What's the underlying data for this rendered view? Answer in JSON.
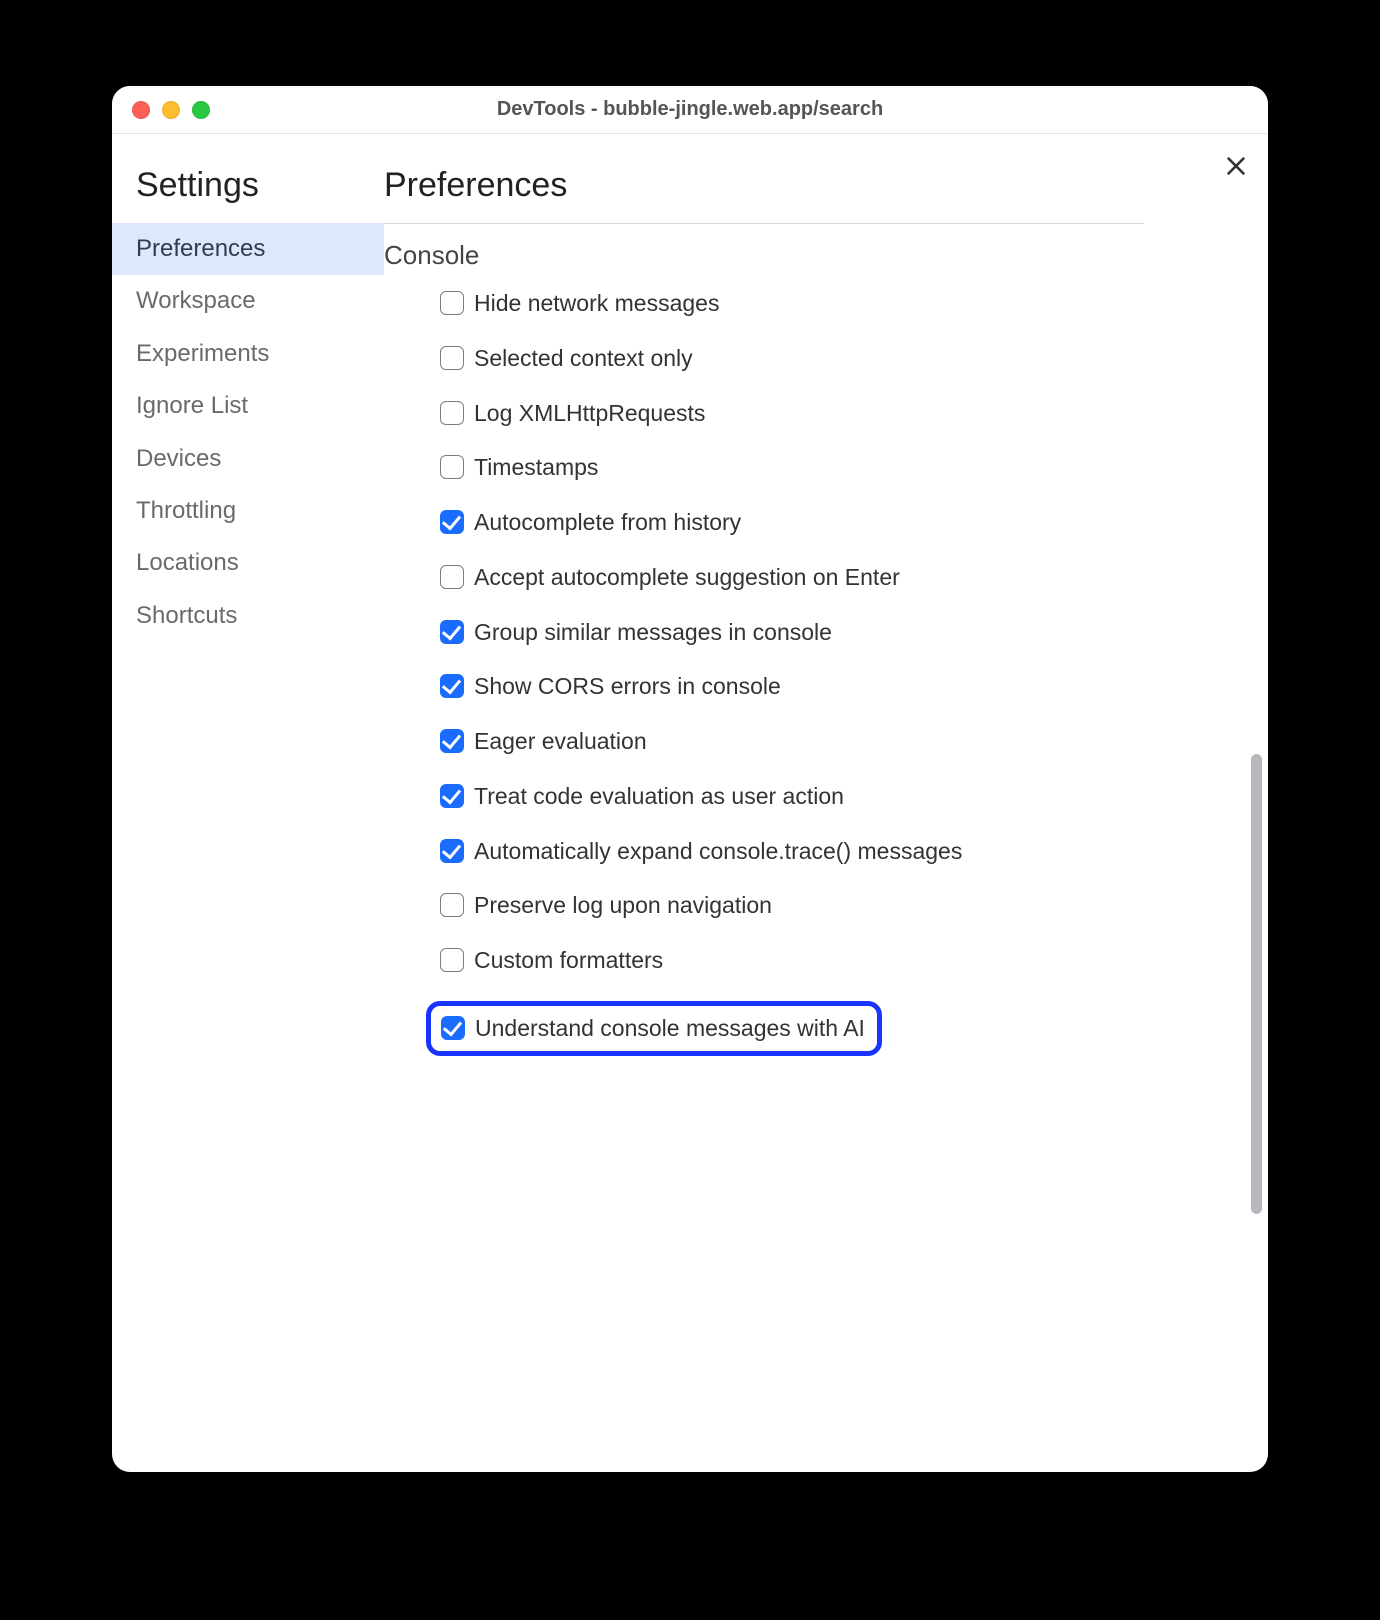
{
  "window": {
    "title": "DevTools - bubble-jingle.web.app/search"
  },
  "sidebar": {
    "heading": "Settings",
    "items": [
      {
        "label": "Preferences",
        "active": true
      },
      {
        "label": "Workspace",
        "active": false
      },
      {
        "label": "Experiments",
        "active": false
      },
      {
        "label": "Ignore List",
        "active": false
      },
      {
        "label": "Devices",
        "active": false
      },
      {
        "label": "Throttling",
        "active": false
      },
      {
        "label": "Locations",
        "active": false
      },
      {
        "label": "Shortcuts",
        "active": false
      }
    ]
  },
  "main": {
    "heading": "Preferences",
    "section": "Console",
    "options": [
      {
        "label": "Hide network messages",
        "checked": false,
        "highlight": false
      },
      {
        "label": "Selected context only",
        "checked": false,
        "highlight": false
      },
      {
        "label": "Log XMLHttpRequests",
        "checked": false,
        "highlight": false
      },
      {
        "label": "Timestamps",
        "checked": false,
        "highlight": false
      },
      {
        "label": "Autocomplete from history",
        "checked": true,
        "highlight": false
      },
      {
        "label": "Accept autocomplete suggestion on Enter",
        "checked": false,
        "highlight": false
      },
      {
        "label": "Group similar messages in console",
        "checked": true,
        "highlight": false
      },
      {
        "label": "Show CORS errors in console",
        "checked": true,
        "highlight": false
      },
      {
        "label": "Eager evaluation",
        "checked": true,
        "highlight": false
      },
      {
        "label": "Treat code evaluation as user action",
        "checked": true,
        "highlight": false
      },
      {
        "label": "Automatically expand console.trace() messages",
        "checked": true,
        "highlight": false
      },
      {
        "label": "Preserve log upon navigation",
        "checked": false,
        "highlight": false
      },
      {
        "label": "Custom formatters",
        "checked": false,
        "highlight": false
      },
      {
        "label": "Understand console messages with AI",
        "checked": true,
        "highlight": true
      }
    ]
  }
}
